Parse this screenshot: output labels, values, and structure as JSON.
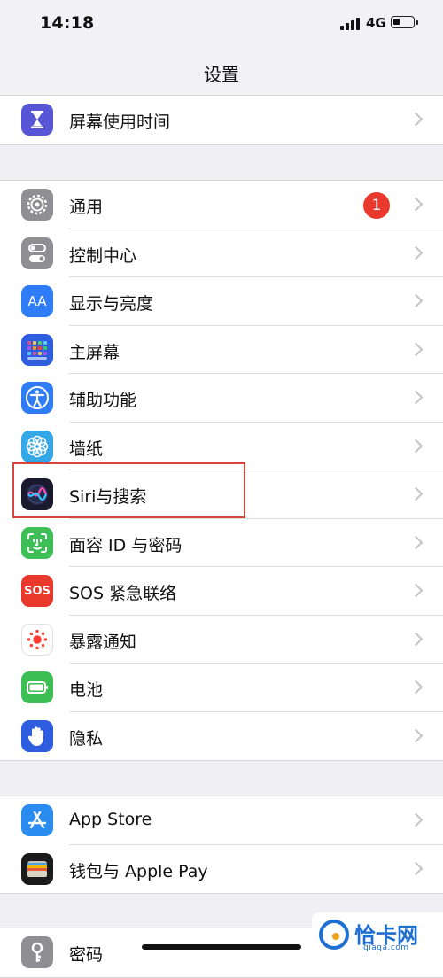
{
  "status_bar": {
    "time": "14:18",
    "network": "4G"
  },
  "nav": {
    "title": "设置"
  },
  "groups": [
    [
      {
        "label": "屏幕使用时间",
        "icon": "hourglass-icon",
        "color": "#5856d6"
      }
    ],
    [
      {
        "label": "通用",
        "icon": "gear-icon",
        "color": "#8e8e93",
        "badge": "1"
      },
      {
        "label": "控制中心",
        "icon": "toggles-icon",
        "color": "#8e8e93"
      },
      {
        "label": "显示与亮度",
        "icon": "text-size-icon",
        "color": "#2f7cf6",
        "icon_text": "AA"
      },
      {
        "label": "主屏幕",
        "icon": "home-grid-icon",
        "color": "#2f5de0"
      },
      {
        "label": "辅助功能",
        "icon": "accessibility-icon",
        "color": "#2f7cf6"
      },
      {
        "label": "墙纸",
        "icon": "flower-icon",
        "color": "#35a7e6"
      },
      {
        "label": "Siri与搜索",
        "icon": "siri-icon",
        "color": "#1a1a2e"
      },
      {
        "label": "面容 ID 与密码",
        "icon": "face-id-icon",
        "color": "#3dbf56"
      },
      {
        "label": "SOS 紧急联络",
        "icon": "sos-icon",
        "color": "#e8392c",
        "icon_text": "SOS"
      },
      {
        "label": "暴露通知",
        "icon": "exposure-icon",
        "color": "#ffffff"
      },
      {
        "label": "电池",
        "icon": "battery-icon",
        "color": "#3dbf56"
      },
      {
        "label": "隐私",
        "icon": "hand-icon",
        "color": "#2f5de0"
      }
    ],
    [
      {
        "label": "App Store",
        "icon": "app-store-icon",
        "color": "#2b8cf0"
      },
      {
        "label": "钱包与 Apple Pay",
        "icon": "wallet-icon",
        "color": "#1a1a1a"
      }
    ],
    [
      {
        "label": "密码",
        "icon": "key-icon",
        "color": "#8e8e93"
      }
    ]
  ],
  "watermark": {
    "text": "恰卡网",
    "url": "qiaqa.com"
  }
}
